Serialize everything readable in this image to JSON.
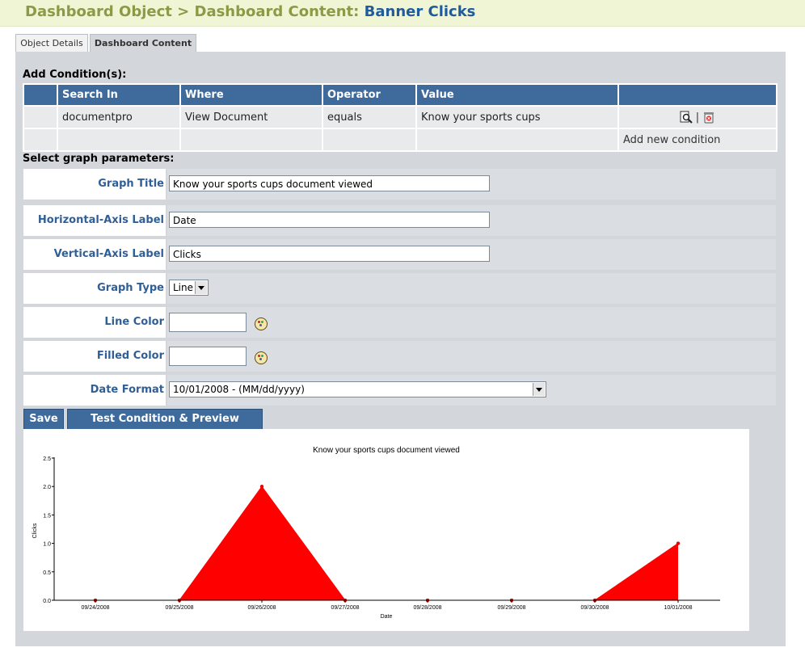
{
  "header": {
    "breadcrumb": "Dashboard Object > Dashboard Content:",
    "current": "Banner Clicks"
  },
  "tabs": [
    {
      "label": "Object Details",
      "active": false
    },
    {
      "label": "Dashboard Content",
      "active": true
    }
  ],
  "conditions": {
    "section_label": "Add Condition(s):",
    "columns": [
      "",
      "Search In",
      "Where",
      "Operator",
      "Value",
      ""
    ],
    "rows": [
      {
        "search_in": "documentpro",
        "where": "View Document",
        "operator": "equals",
        "value": "Know your sports cups"
      }
    ],
    "add_link": "Add new condition"
  },
  "graph_params": {
    "section_label": "Select graph parameters:",
    "title_label": "Graph Title",
    "title_value": "Know your sports cups document viewed",
    "haxis_label": "Horizontal-Axis Label",
    "haxis_value": "Date",
    "vaxis_label": "Vertical-Axis Label",
    "vaxis_value": "Clicks",
    "type_label": "Graph Type",
    "type_value": "Line",
    "line_color_label": "Line Color",
    "line_color_value": "",
    "filled_color_label": "Filled Color",
    "filled_color_value": "",
    "date_format_label": "Date Format",
    "date_format_value": "10/01/2008 - (MM/dd/yyyy)"
  },
  "buttons": {
    "save": "Save",
    "test": "Test Condition & Preview"
  },
  "colors": {
    "fill": "#ff0000",
    "header_blue": "#3f6a9c",
    "breadcrumb_green": "#8c9a46"
  },
  "chart_data": {
    "type": "area",
    "title": "Know your sports cups document viewed",
    "xlabel": "Date",
    "ylabel": "Clicks",
    "categories": [
      "09/24/2008",
      "09/25/2008",
      "09/26/2008",
      "09/27/2008",
      "09/28/2008",
      "09/29/2008",
      "09/30/2008",
      "10/01/2008"
    ],
    "values": [
      0,
      0,
      2,
      0,
      0,
      0,
      0,
      1
    ],
    "ylim": [
      0,
      2.5
    ],
    "yticks": [
      "0.0",
      "0.5",
      "1.0",
      "1.5",
      "2.0",
      "2.5"
    ],
    "grid": false
  }
}
